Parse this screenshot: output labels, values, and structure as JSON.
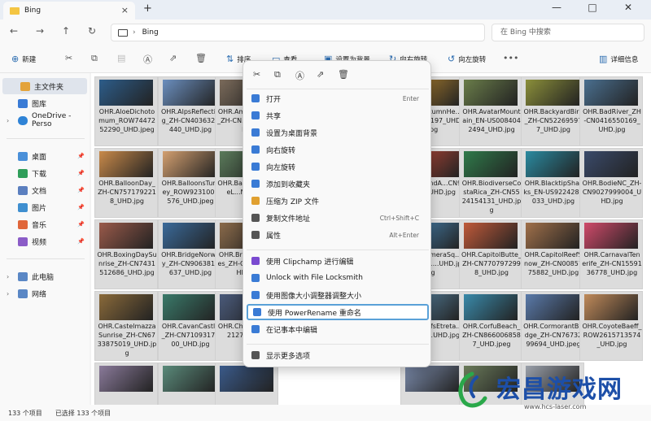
{
  "window": {
    "tab_title": "Bing",
    "new_tab": "+",
    "close_tab": "×",
    "min": "—",
    "max": "□",
    "close": "✕"
  },
  "address": {
    "back": "←",
    "forward": "→",
    "up": "↑",
    "refresh": "↻",
    "path": "Bing",
    "separator": "›",
    "search_placeholder": "在 Bing 中搜索"
  },
  "toolbar": {
    "new_label": "新建",
    "sort_label": "排序",
    "view_label": "查看",
    "set_bg_label": "设置为背景",
    "rotate_right_label": "向右旋转",
    "rotate_left_label": "向左旋转",
    "more_label": "•••",
    "details_label": "详细信息"
  },
  "sidebar": {
    "items": [
      {
        "label": "主文件夹",
        "color": "#e3a33b"
      },
      {
        "label": "图库",
        "color": "#3a7bd5"
      },
      {
        "label": "OneDrive - Perso",
        "color": "#2f83d6"
      },
      {
        "label": "桌面",
        "color": "#4a90d9"
      },
      {
        "label": "下载",
        "color": "#2f9e5a"
      },
      {
        "label": "文档",
        "color": "#5b7fbf"
      },
      {
        "label": "图片",
        "color": "#3f8fd0"
      },
      {
        "label": "音乐",
        "color": "#e0663a"
      },
      {
        "label": "视频",
        "color": "#8b5cc7"
      },
      {
        "label": "此电脑",
        "color": "#5a87c5"
      },
      {
        "label": "网络",
        "color": "#5a87c5"
      }
    ]
  },
  "files": [
    {
      "name": "OHR.AloeDichotomum_ROW7447252290_UHD.jpeg",
      "color": "#2d5d8a"
    },
    {
      "name": "OHR.AlpsReflecting_ZH-CN4036320440_UHD.jpg",
      "color": "#6b8fbf"
    },
    {
      "name": "OHR.AmeProvince_ZH-CN...5151_UHD...",
      "color": "#7a6a5a"
    },
    {
      "name": "OHR.AutumnHe...ZH-CN...197_UHD.jpg",
      "color": "#b8872f"
    },
    {
      "name": "OHR.AvatarMountain_EN-US0084042494_UHD.jpg",
      "color": "#6a7d4a"
    },
    {
      "name": "OHR.BackyardBird_ZH-CN522695977_UHD.jpg",
      "color": "#8b8f3a"
    },
    {
      "name": "OHR.BadRiver_ZH-CN0416550169_UHD.jpg",
      "color": "#4a6f8f"
    },
    {
      "name": "OHR.BalloonDay_ZH-CN7571792218_UHD.jpg",
      "color": "#c98a4a"
    },
    {
      "name": "OHR.BalloonsTurkey_ROW9231009576_UHD.jpeg",
      "color": "#d4a070"
    },
    {
      "name": "OHR.BambooCastleL...N3201...",
      "color": "#5a7a5a"
    },
    {
      "name": "OHR.BendA...CN9954...UHD.jpg",
      "color": "#c04a3a"
    },
    {
      "name": "OHR.BiodiverseCostaRica_ZH-CN5524154131_UHD.jpg",
      "color": "#2f7a4a"
    },
    {
      "name": "OHR.BlacktipSharks_EN-US9224288033_UHD.jpg",
      "color": "#2a8aa0"
    },
    {
      "name": "OHR.BodieNC_ZH-CN9027999004_UHD.jpg",
      "color": "#3a4a6a"
    },
    {
      "name": "OHR.BoxingDaySunrise_ZH-CN7431512686_UHD.jpg",
      "color": "#9a5a4a"
    },
    {
      "name": "OHR.BridgeNorway_ZH-CN9063814637_UHD.jpg",
      "color": "#3a6a9a"
    },
    {
      "name": "OHR.BridgeOfBoxes_ZH-CN7219...UHD.jpg",
      "color": "#8a6a4a"
    },
    {
      "name": "OHR.CameraSq...EN-US01...UHD.jpg",
      "color": "#4a8aba"
    },
    {
      "name": "OHR.CapitolButte_ZH-CN7707972998_UHD.jpg",
      "color": "#c05a3a"
    },
    {
      "name": "OHR.CapitolReefSnow_ZH-CN0085775882_UHD.jpg",
      "color": "#a0704a"
    },
    {
      "name": "OHR.CarnavalTenerife_ZH-CN1559136778_UHD.jpg",
      "color": "#d04a6a"
    },
    {
      "name": "OHR.CastelmazzaSunrise_ZH-CN6733875019_UHD.jpg",
      "color": "#8a6a3a"
    },
    {
      "name": "OHR.CavanCastle_ZH-CN7109317900_UHD.jpg",
      "color": "#3a7a6a"
    },
    {
      "name": "OHR.Chure_RO...82127_UHD...",
      "color": "#4a5a7a"
    },
    {
      "name": "OHR.CliffsEtreta...60884...UHD.jpg",
      "color": "#5a8aaa"
    },
    {
      "name": "OHR.CorfuBeach_ZH-CN8660068587_UHD.jpeg",
      "color": "#3a8aaa"
    },
    {
      "name": "OHR.CormorantBridge_ZH-CN7673299694_UHD.jpeg",
      "color": "#5a7aaa"
    },
    {
      "name": "OHR.CoyoteBaeff_ROW2615713574_UHD.jpg",
      "color": "#c08a5a"
    },
    {
      "name": "",
      "color": "#8a7a9a"
    },
    {
      "name": "",
      "color": "#5a8a7a"
    },
    {
      "name": "",
      "color": "#3a5a8a"
    },
    {
      "name": "",
      "color": "#7a8aaa"
    },
    {
      "name": "",
      "color": "#6a7a5a"
    },
    {
      "name": "",
      "color": "#9aa0aa"
    }
  ],
  "context_menu": {
    "top_icons": [
      "scissors-icon",
      "copy-icon",
      "rename-icon",
      "share-icon",
      "delete-icon"
    ],
    "top_glyphs": [
      "✂",
      "⧉",
      "Ⓐ",
      "⇗",
      "🗑"
    ],
    "items": [
      {
        "label": "打开",
        "shortcut": "Enter",
        "color": "#3a7bd5"
      },
      {
        "label": "共享",
        "shortcut": "",
        "color": "#3a7bd5"
      },
      {
        "label": "设置为桌面背景",
        "shortcut": "",
        "color": "#3a7bd5"
      },
      {
        "label": "向右旋转",
        "shortcut": "",
        "color": "#3a7bd5"
      },
      {
        "label": "向左旋转",
        "shortcut": "",
        "color": "#3a7bd5"
      },
      {
        "label": "添加到收藏夹",
        "shortcut": "",
        "color": "#3a7bd5"
      },
      {
        "label": "压缩为 ZIP 文件",
        "shortcut": "",
        "color": "#e0a030"
      },
      {
        "label": "复制文件地址",
        "shortcut": "Ctrl+Shift+C",
        "color": "#555555"
      },
      {
        "label": "属性",
        "shortcut": "Alt+Enter",
        "color": "#555555"
      },
      {
        "label": "使用 Clipchamp 进行编辑",
        "shortcut": "",
        "color": "#7a4ad0"
      },
      {
        "label": "Unlock with File Locksmith",
        "shortcut": "",
        "color": "#3a7bd5"
      },
      {
        "label": "使用图像大小调整器调整大小",
        "shortcut": "",
        "color": "#3a7bd5"
      },
      {
        "label": "使用 PowerRename 重命名",
        "shortcut": "",
        "color": "#3a7bd5"
      },
      {
        "label": "在记事本中编辑",
        "shortcut": "",
        "color": "#3a7bd5"
      },
      {
        "label": "显示更多选项",
        "shortcut": "",
        "color": "#555555"
      }
    ]
  },
  "status": {
    "count": "133 个项目",
    "selected": "已选择 133 个项目"
  },
  "watermark": {
    "text": "宏昌游戏网",
    "url": "www.hcs-laser.com"
  }
}
